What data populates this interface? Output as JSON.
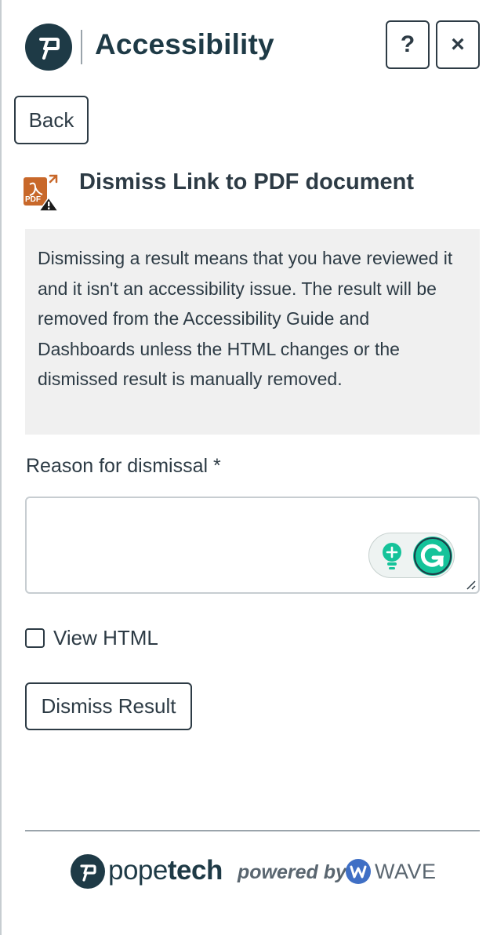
{
  "header": {
    "title": "Accessibility",
    "help_label": "?",
    "close_label": "×"
  },
  "back_label": "Back",
  "section": {
    "title": "Dismiss Link to PDF document",
    "icon": "pdf-warning-icon",
    "description": "Dismissing a result means that you have reviewed it and it isn't an accessibility issue. The result will be removed from the Accessibility Guide and Dashboards unless the HTML changes or the dismissed result is manually removed."
  },
  "reason": {
    "label": "Reason for dismissal *",
    "value": ""
  },
  "view_html": {
    "label": "View HTML",
    "checked": false
  },
  "dismiss_label": "Dismiss Result",
  "footer": {
    "brand_light": "pope",
    "brand_bold": "tech",
    "powered_by": "powered by",
    "wave": "WAVE"
  },
  "colors": {
    "brand_dark": "#1e3a46",
    "text": "#2d3b45",
    "desc_bg": "#f0f0f0",
    "grammarly": "#15c39a",
    "wave": "#3f6fc5"
  }
}
